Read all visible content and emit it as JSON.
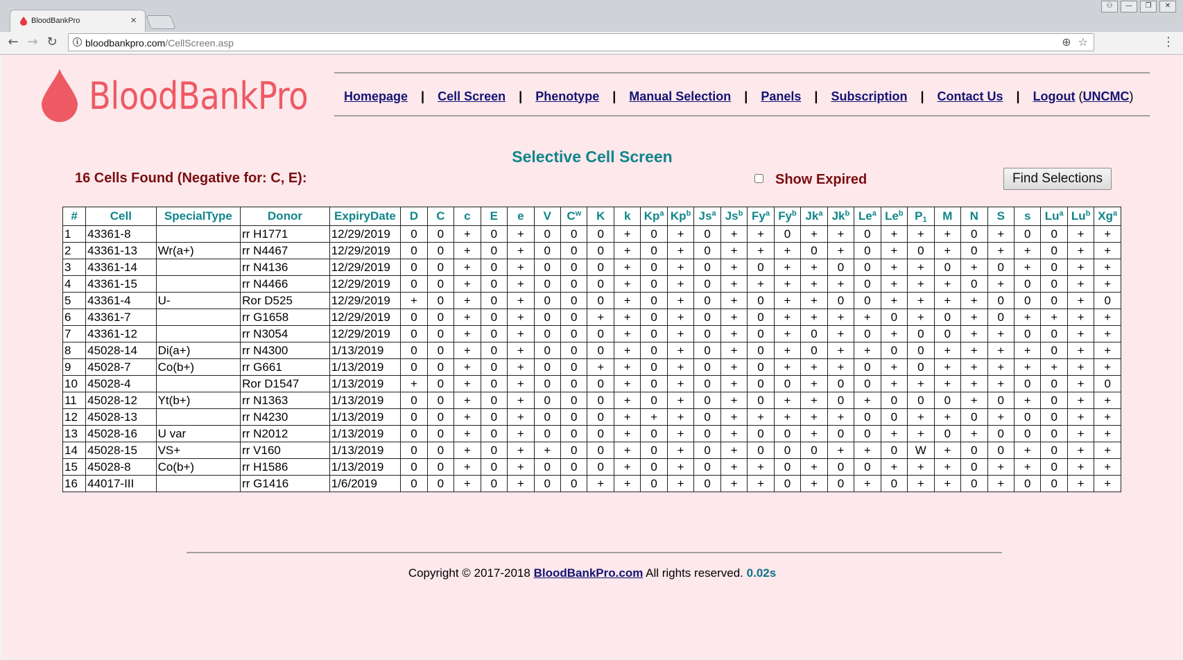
{
  "browser": {
    "tab_title": "BloodBankPro",
    "tab_close": "×",
    "url_host": "bloodbankpro.com",
    "url_path": "/CellScreen.asp",
    "back": "←",
    "forward": "→",
    "reload": "↻",
    "info": "i",
    "zoom": "⊕",
    "star": "☆",
    "menu": "⋮",
    "win_user": "⚇",
    "win_min": "—",
    "win_restore": "❐",
    "win_close": "✕"
  },
  "logo": {
    "text": "BloodBankPro",
    "color": "#ee5a63"
  },
  "nav": {
    "homepage": "Homepage",
    "cell_screen": "Cell Screen",
    "phenotype": "Phenotype",
    "manual_selection": "Manual Selection",
    "panels": "Panels",
    "subscription": "Subscription",
    "contact_us": "Contact Us",
    "logout": "Logout",
    "user": "UNCMC",
    "sep": "|",
    "paren_open": "(",
    "paren_close": ")"
  },
  "screen": {
    "title": "Selective Cell Screen",
    "found_text": "16 Cells Found (Negative for: C, E):",
    "show_expired": "Show Expired",
    "find_button": "Find Selections"
  },
  "table": {
    "headers": [
      {
        "base": "#"
      },
      {
        "base": "Cell"
      },
      {
        "base": "SpecialType"
      },
      {
        "base": "Donor"
      },
      {
        "base": "ExpiryDate"
      },
      {
        "base": "D"
      },
      {
        "base": "C"
      },
      {
        "base": "c"
      },
      {
        "base": "E"
      },
      {
        "base": "e"
      },
      {
        "base": "V"
      },
      {
        "base": "C",
        "sup": "w"
      },
      {
        "base": "K"
      },
      {
        "base": "k"
      },
      {
        "base": "Kp",
        "sup": "a"
      },
      {
        "base": "Kp",
        "sup": "b"
      },
      {
        "base": "Js",
        "sup": "a"
      },
      {
        "base": "Js",
        "sup": "b"
      },
      {
        "base": "Fy",
        "sup": "a"
      },
      {
        "base": "Fy",
        "sup": "b"
      },
      {
        "base": "Jk",
        "sup": "a"
      },
      {
        "base": "Jk",
        "sup": "b"
      },
      {
        "base": "Le",
        "sup": "a"
      },
      {
        "base": "Le",
        "sup": "b"
      },
      {
        "base": "P",
        "sub": "1"
      },
      {
        "base": "M"
      },
      {
        "base": "N"
      },
      {
        "base": "S"
      },
      {
        "base": "s"
      },
      {
        "base": "Lu",
        "sup": "a"
      },
      {
        "base": "Lu",
        "sup": "b"
      },
      {
        "base": "Xg",
        "sup": "a"
      }
    ],
    "rows": [
      [
        "1",
        "43361-8",
        "",
        "rr H1771",
        "12/29/2019",
        "0",
        "0",
        "+",
        "0",
        "+",
        "0",
        "0",
        "0",
        "+",
        "0",
        "+",
        "0",
        "+",
        "+",
        "0",
        "+",
        "+",
        "0",
        "+",
        "+",
        "+",
        "0",
        "+",
        "0",
        "0",
        "+",
        "+"
      ],
      [
        "2",
        "43361-13",
        "Wr(a+)",
        "rr N4467",
        "12/29/2019",
        "0",
        "0",
        "+",
        "0",
        "+",
        "0",
        "0",
        "0",
        "+",
        "0",
        "+",
        "0",
        "+",
        "+",
        "+",
        "0",
        "+",
        "0",
        "+",
        "0",
        "+",
        "0",
        "+",
        "+",
        "0",
        "+",
        "+"
      ],
      [
        "3",
        "43361-14",
        "",
        "rr N4136",
        "12/29/2019",
        "0",
        "0",
        "+",
        "0",
        "+",
        "0",
        "0",
        "0",
        "+",
        "0",
        "+",
        "0",
        "+",
        "0",
        "+",
        "+",
        "0",
        "0",
        "+",
        "+",
        "0",
        "+",
        "0",
        "+",
        "0",
        "+",
        "+"
      ],
      [
        "4",
        "43361-15",
        "",
        "rr N4466",
        "12/29/2019",
        "0",
        "0",
        "+",
        "0",
        "+",
        "0",
        "0",
        "0",
        "+",
        "0",
        "+",
        "0",
        "+",
        "+",
        "+",
        "+",
        "+",
        "0",
        "+",
        "+",
        "+",
        "0",
        "+",
        "0",
        "0",
        "+",
        "+"
      ],
      [
        "5",
        "43361-4",
        "U-",
        "Ror D525",
        "12/29/2019",
        "+",
        "0",
        "+",
        "0",
        "+",
        "0",
        "0",
        "0",
        "+",
        "0",
        "+",
        "0",
        "+",
        "0",
        "+",
        "+",
        "0",
        "0",
        "+",
        "+",
        "+",
        "+",
        "0",
        "0",
        "0",
        "+",
        "0"
      ],
      [
        "6",
        "43361-7",
        "",
        "rr G1658",
        "12/29/2019",
        "0",
        "0",
        "+",
        "0",
        "+",
        "0",
        "0",
        "+",
        "+",
        "0",
        "+",
        "0",
        "+",
        "0",
        "+",
        "+",
        "+",
        "+",
        "0",
        "+",
        "0",
        "+",
        "0",
        "+",
        "+",
        "+",
        "+"
      ],
      [
        "7",
        "43361-12",
        "",
        "rr N3054",
        "12/29/2019",
        "0",
        "0",
        "+",
        "0",
        "+",
        "0",
        "0",
        "0",
        "+",
        "0",
        "+",
        "0",
        "+",
        "0",
        "+",
        "0",
        "+",
        "0",
        "+",
        "0",
        "0",
        "+",
        "+",
        "0",
        "0",
        "+",
        "+"
      ],
      [
        "8",
        "45028-14",
        "Di(a+)",
        "rr N4300",
        "1/13/2019",
        "0",
        "0",
        "+",
        "0",
        "+",
        "0",
        "0",
        "0",
        "+",
        "0",
        "+",
        "0",
        "+",
        "0",
        "+",
        "0",
        "+",
        "+",
        "0",
        "0",
        "+",
        "+",
        "+",
        "+",
        "0",
        "+",
        "+"
      ],
      [
        "9",
        "45028-7",
        "Co(b+)",
        "rr G661",
        "1/13/2019",
        "0",
        "0",
        "+",
        "0",
        "+",
        "0",
        "0",
        "+",
        "+",
        "0",
        "+",
        "0",
        "+",
        "0",
        "+",
        "+",
        "+",
        "0",
        "+",
        "0",
        "+",
        "+",
        "+",
        "+",
        "+",
        "+",
        "+"
      ],
      [
        "10",
        "45028-4",
        "",
        "Ror D1547",
        "1/13/2019",
        "+",
        "0",
        "+",
        "0",
        "+",
        "0",
        "0",
        "0",
        "+",
        "0",
        "+",
        "0",
        "+",
        "0",
        "0",
        "+",
        "0",
        "0",
        "+",
        "+",
        "+",
        "+",
        "+",
        "0",
        "0",
        "+",
        "0"
      ],
      [
        "11",
        "45028-12",
        "Yt(b+)",
        "rr N1363",
        "1/13/2019",
        "0",
        "0",
        "+",
        "0",
        "+",
        "0",
        "0",
        "0",
        "+",
        "0",
        "+",
        "0",
        "+",
        "0",
        "+",
        "+",
        "0",
        "+",
        "0",
        "0",
        "0",
        "+",
        "0",
        "+",
        "0",
        "+",
        "+"
      ],
      [
        "12",
        "45028-13",
        "",
        "rr N4230",
        "1/13/2019",
        "0",
        "0",
        "+",
        "0",
        "+",
        "0",
        "0",
        "0",
        "+",
        "+",
        "+",
        "0",
        "+",
        "+",
        "+",
        "+",
        "+",
        "0",
        "0",
        "+",
        "+",
        "0",
        "+",
        "0",
        "0",
        "+",
        "+"
      ],
      [
        "13",
        "45028-16",
        "U var",
        "rr N2012",
        "1/13/2019",
        "0",
        "0",
        "+",
        "0",
        "+",
        "0",
        "0",
        "0",
        "+",
        "0",
        "+",
        "0",
        "+",
        "0",
        "0",
        "+",
        "0",
        "0",
        "+",
        "+",
        "0",
        "+",
        "0",
        "0",
        "0",
        "+",
        "+"
      ],
      [
        "14",
        "45028-15",
        "VS+",
        "rr V160",
        "1/13/2019",
        "0",
        "0",
        "+",
        "0",
        "+",
        "+",
        "0",
        "0",
        "+",
        "0",
        "+",
        "0",
        "+",
        "0",
        "0",
        "0",
        "+",
        "+",
        "0",
        "W",
        "+",
        "0",
        "0",
        "+",
        "0",
        "+",
        "+"
      ],
      [
        "15",
        "45028-8",
        "Co(b+)",
        "rr H1586",
        "1/13/2019",
        "0",
        "0",
        "+",
        "0",
        "+",
        "0",
        "0",
        "0",
        "+",
        "0",
        "+",
        "0",
        "+",
        "+",
        "0",
        "+",
        "0",
        "0",
        "+",
        "+",
        "+",
        "0",
        "+",
        "+",
        "0",
        "+",
        "+"
      ],
      [
        "16",
        "44017-III",
        "",
        "rr G1416",
        "1/6/2019",
        "0",
        "0",
        "+",
        "0",
        "+",
        "0",
        "0",
        "+",
        "+",
        "0",
        "+",
        "0",
        "+",
        "+",
        "0",
        "+",
        "0",
        "+",
        "0",
        "+",
        "+",
        "0",
        "+",
        "0",
        "0",
        "+",
        "+"
      ]
    ]
  },
  "footer": {
    "prefix": "Copyright © 2017-2018",
    "link": "BloodBankPro.com",
    "suffix": "All rights reserved.",
    "time": "0.02s"
  },
  "colors": {
    "page_bg": "#fde8ec",
    "heading_teal": "#10858a",
    "dark_red": "#7a0e0e",
    "link_navy": "#141472"
  }
}
